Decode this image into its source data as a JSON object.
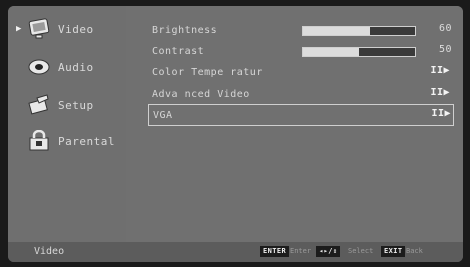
{
  "sidebar": {
    "items": [
      {
        "label": "Video",
        "icon": "monitor-icon",
        "selected": true
      },
      {
        "label": "Audio",
        "icon": "speaker-icon",
        "selected": false
      },
      {
        "label": "Setup",
        "icon": "wrench-icon",
        "selected": false
      },
      {
        "label": "Parental",
        "icon": "lock-icon",
        "selected": false
      }
    ]
  },
  "menu": {
    "rows": [
      {
        "label": "Brightness",
        "value": "60",
        "level": 0.6
      },
      {
        "label": "Contrast",
        "value": "50",
        "level": 0.5
      },
      {
        "label": "Color Tempe ratur",
        "action_icon": "II▶"
      },
      {
        "label": "Adva nced Video",
        "action_icon": "II▶"
      },
      {
        "label": "VGA",
        "action_icon": "II▶",
        "selected": true
      }
    ]
  },
  "footer": {
    "title": "Video",
    "keys": [
      {
        "key": "ENTER",
        "desc": "Enter"
      },
      {
        "key": "◂▸/⇕",
        "desc": "Select"
      },
      {
        "key": "EXIT",
        "desc": "Back"
      }
    ]
  },
  "colors": {
    "background": "#6d6d6d",
    "text": "#d9d9d9",
    "key_bg": "#1c1c1c"
  }
}
